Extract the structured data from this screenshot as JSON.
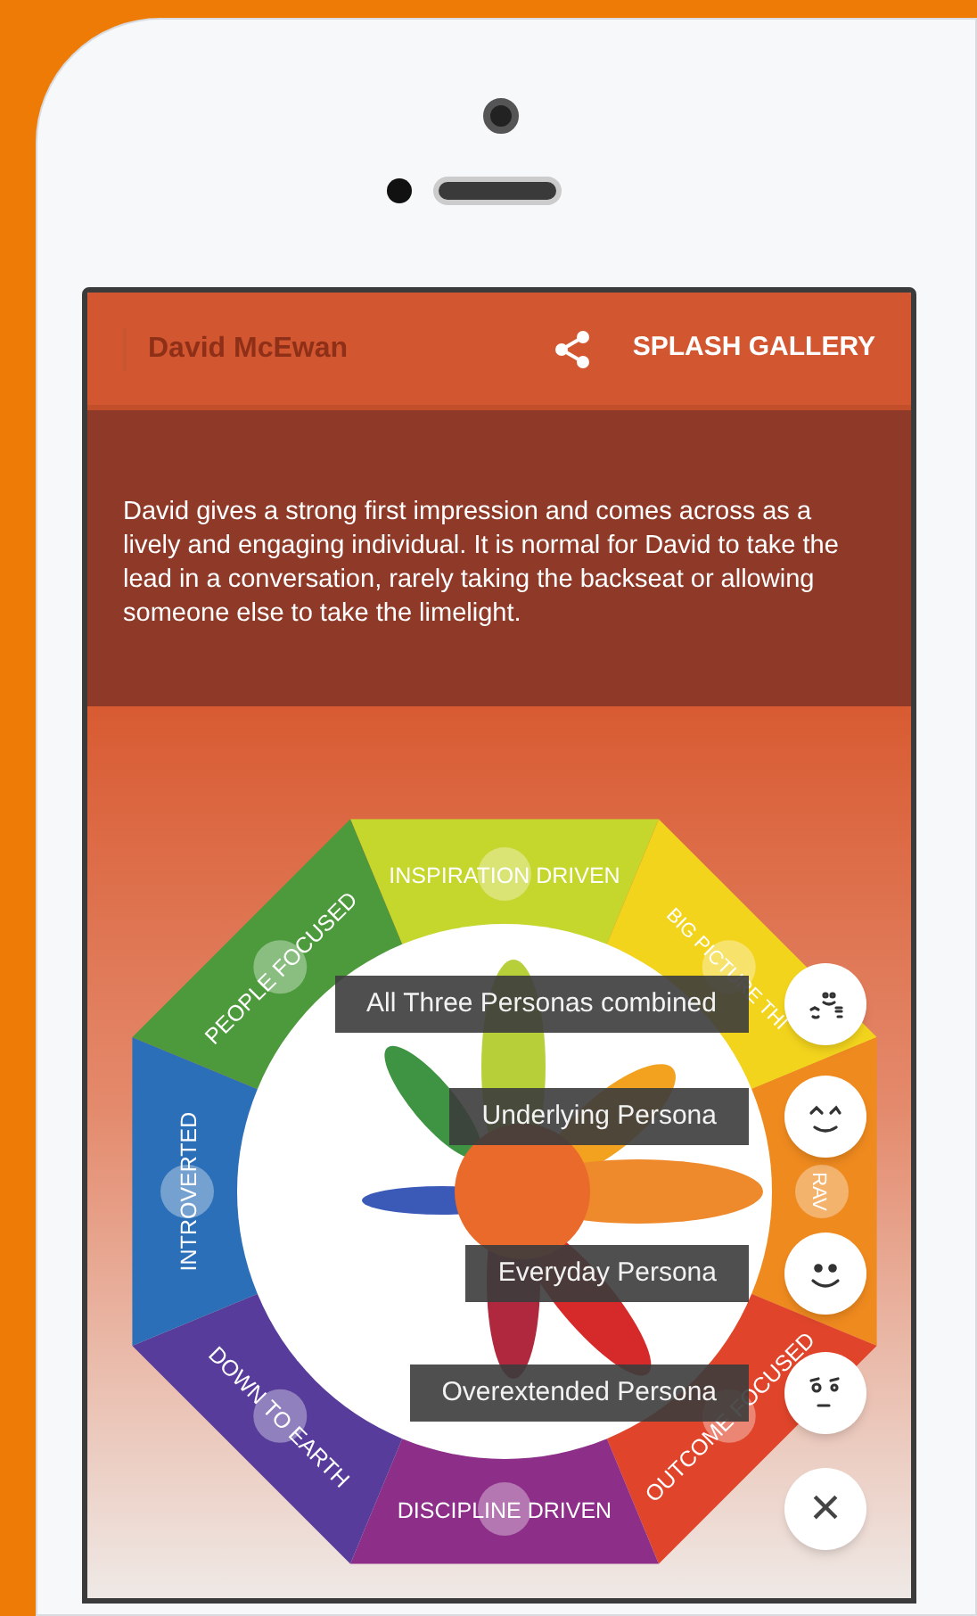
{
  "app_bar": {
    "title": "David McEwan",
    "action": "SPLASH GALLERY"
  },
  "description": "David gives a strong first impression and comes across as a lively and engaging individual. It is normal for David to take the lead in a conversation, rarely taking the backseat or allowing someone else to take the limelight.",
  "wheel_labels": [
    "INSPIRATION DRIVEN",
    "BIG PICTURE THI",
    "RAV",
    "OUTCOME FOCUSED",
    "DISCIPLINE DRIVEN",
    "DOWN TO EARTH",
    "INTROVERTED",
    "PEOPLE FOCUSED"
  ],
  "persona_menu": [
    {
      "label": "All Three Personas combined",
      "kind": "group"
    },
    {
      "label": "Underlying Persona",
      "kind": "wink"
    },
    {
      "label": "Everyday Persona",
      "kind": "smile"
    },
    {
      "label": "Overextended Persona",
      "kind": "frown"
    }
  ],
  "close_button": "×"
}
